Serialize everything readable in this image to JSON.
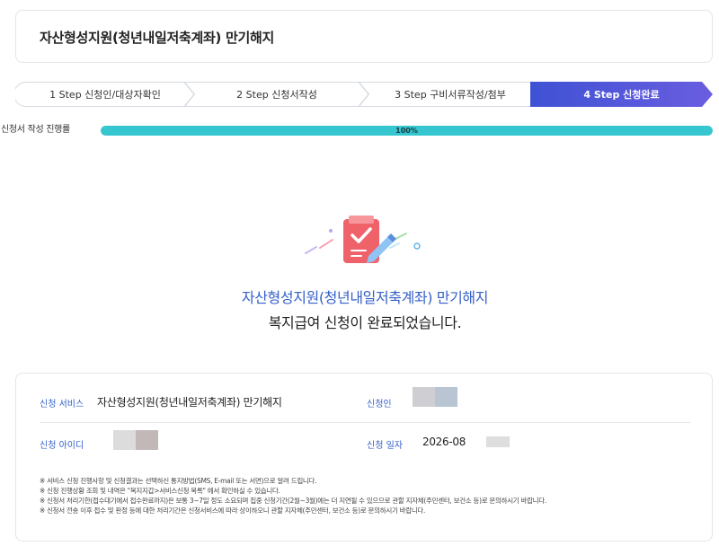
{
  "page": {
    "title": "자산형성지원(청년내일저축계좌) 만기해지"
  },
  "steps": [
    {
      "label": "1 Step 신청인/대상자확인",
      "active": false
    },
    {
      "label": "2 Step 신청서작성",
      "active": false
    },
    {
      "label": "3 Step 구비서류작성/첨부",
      "active": false
    },
    {
      "label": "4 Step 신청완료",
      "active": true
    }
  ],
  "progress": {
    "label": "신청서 작성 진행률",
    "value": 100,
    "text": "100%"
  },
  "completion": {
    "service_name": "자산형성지원(청년내일저축계좌) 만기해지",
    "message": "복지급여 신청이 완료되었습니다."
  },
  "summary": {
    "service_label": "신청 서비스",
    "service_value": "자산형성지원(청년내일저축계좌) 만기해지",
    "applicant_label": "신청인",
    "id_label": "신청 아이디",
    "date_label": "신청 일자",
    "date_value": "2026-08"
  },
  "notes": [
    "※ 서비스 신청 진행사항 및 신청결과는 선택하신 통지방법(SMS, E-mail 또는 서면)으로 알려 드립니다.",
    "※ 신청 진행상황 조회 및 내역은 \"복지지갑>서비스신청 목록\" 에서 확인하실 수 있습니다.",
    "※ 신청서 처리기한(접수대기에서 접수완료까지)은 보통 3~7일 정도 소요되며 집중 신청기간(2월~3월)에는 더 지연될 수 있으므로 관할 지자체(주민센터, 보건소 등)로 문의하시기 바랍니다.",
    "※ 신청서 전송 이후 접수 및 판정 등에 대한 처리기간은 신청서비스에 따라 상이하오니 관할 지자체(주민센터, 보건소 등)로 문의하시기 바랍니다."
  ],
  "colors": {
    "accent": "#3561c8",
    "progress": "#35c6cf",
    "step_active_start": "#3f52d4",
    "step_active_end": "#6a5de0"
  }
}
